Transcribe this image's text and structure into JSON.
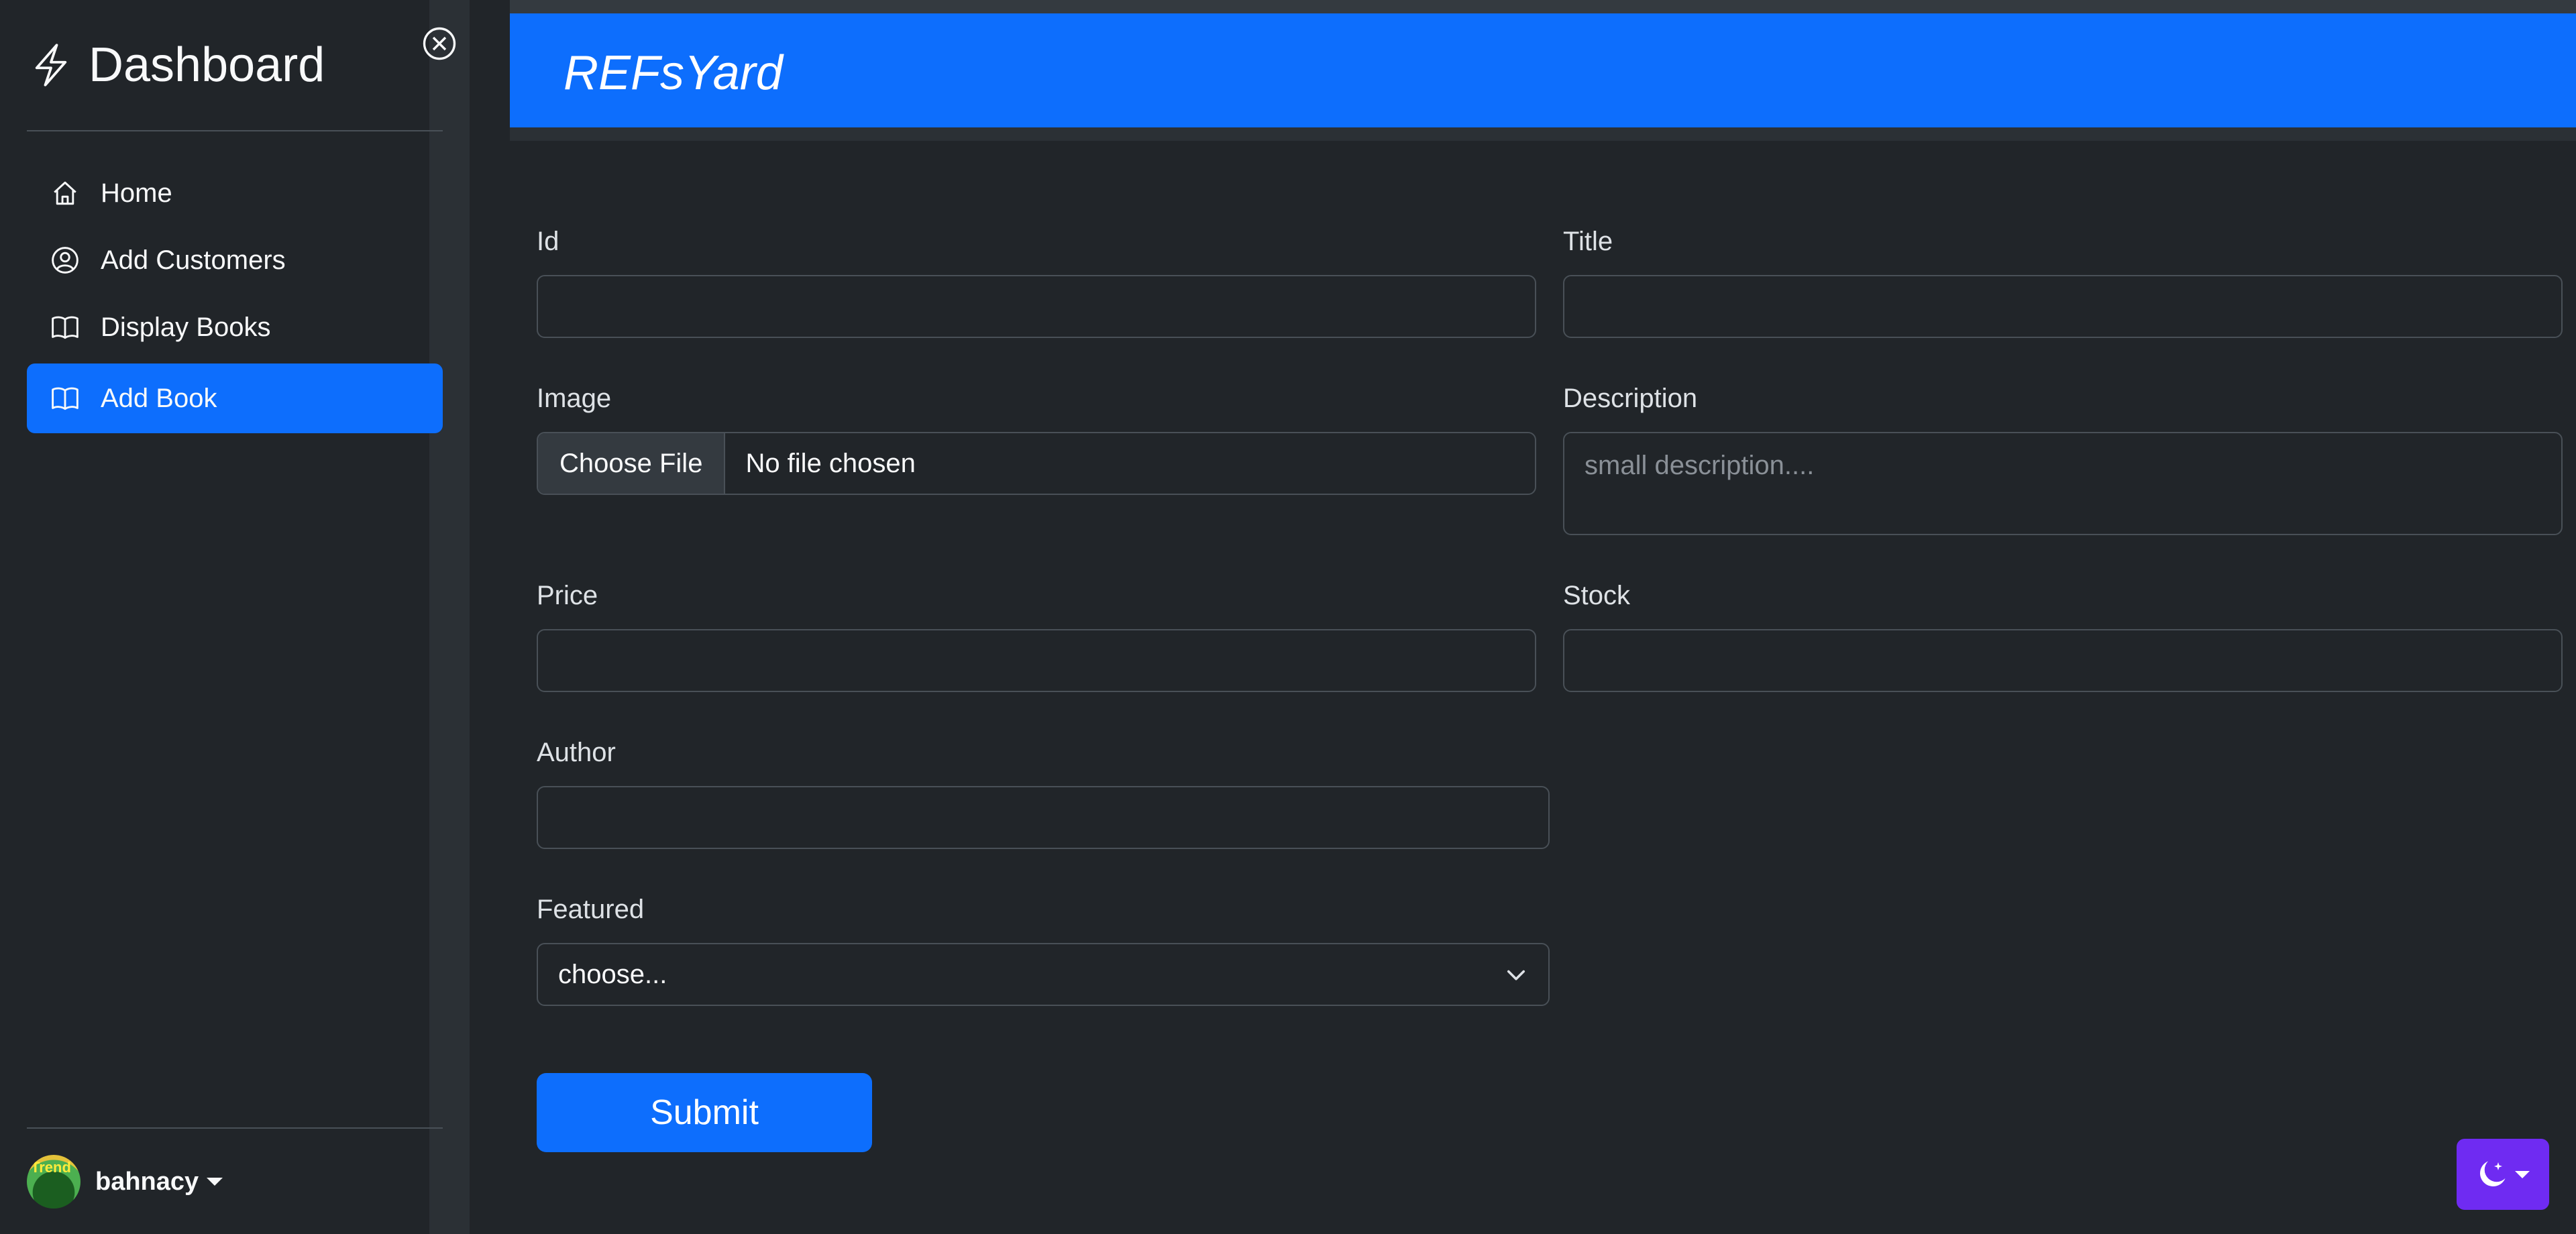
{
  "sidebar": {
    "brand": "Dashboard",
    "items": [
      {
        "label": "Home",
        "icon": "home-icon"
      },
      {
        "label": "Add Customers",
        "icon": "person-circle-icon"
      },
      {
        "label": "Display Books",
        "icon": "book-icon"
      },
      {
        "label": "Add Book",
        "icon": "book-icon",
        "active": true
      }
    ],
    "user": {
      "name": "bahnacy",
      "avatar_text": "Trend"
    }
  },
  "header": {
    "title": "REFsYard"
  },
  "form": {
    "id_label": "Id",
    "title_label": "Title",
    "image_label": "Image",
    "file_button": "Choose File",
    "file_status": "No file chosen",
    "description_label": "Description",
    "description_placeholder": "small description....",
    "price_label": "Price",
    "stock_label": "Stock",
    "author_label": "Author",
    "featured_label": "Featured",
    "featured_value": "choose...",
    "submit_label": "Submit"
  },
  "colors": {
    "accent": "#0d6efd",
    "theme_button": "#6f2bf2",
    "background": "#212529"
  }
}
